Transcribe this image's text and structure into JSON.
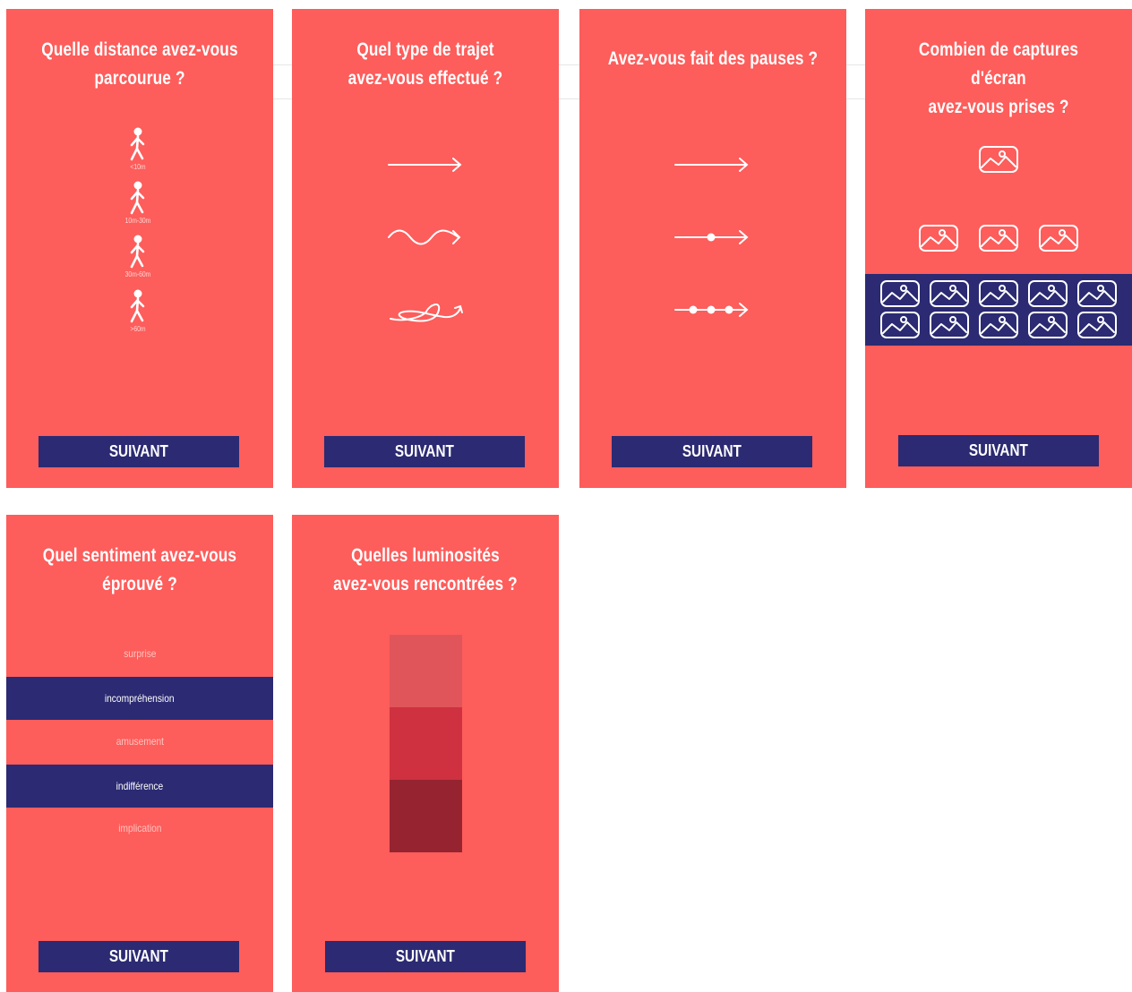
{
  "screens": [
    {
      "title_lines": [
        "Quelle distance avez-vous",
        "parcourue ?"
      ],
      "distance_labels": [
        "<10m",
        "10m-30m",
        "30m-60m",
        ">60m"
      ],
      "button": "SUIVANT"
    },
    {
      "title_lines": [
        "Quel type de trajet",
        "avez-vous effectué ?"
      ],
      "trajet_types": [
        "straight-arrow-icon",
        "wavy-arrow-icon",
        "looped-arrow-icon"
      ],
      "button": "SUIVANT"
    },
    {
      "title_lines": [
        "Avez-vous fait des pauses ?"
      ],
      "pause_options": [
        "no-pause-arrow-icon",
        "one-pause-arrow-icon",
        "three-pause-arrow-icon"
      ],
      "button": "SUIVANT"
    },
    {
      "title_lines": [
        "Combien de captures d'écran",
        "avez-vous prises ?"
      ],
      "capture_options": [
        1,
        3,
        10
      ],
      "selected_capture_option": 10,
      "button": "SUIVANT"
    },
    {
      "title_lines": [
        "Quel sentiment avez-vous",
        "éprouvé ?"
      ],
      "sentiments": [
        {
          "label": "surprise",
          "selected": false
        },
        {
          "label": "incompréhension",
          "selected": true
        },
        {
          "label": "amusement",
          "selected": false
        },
        {
          "label": "indifférence",
          "selected": true
        },
        {
          "label": "implication",
          "selected": false
        }
      ],
      "button": "SUIVANT"
    },
    {
      "title_lines": [
        "Quelles luminosités",
        "avez-vous rencontrées ?"
      ],
      "luminosity_swatches": [
        "#e0555a",
        "#cf3140",
        "#952430"
      ],
      "button": "SUIVANT"
    }
  ],
  "colors": {
    "background": "#fd5d5b",
    "accent": "#2b2a72",
    "text": "#ffffff"
  }
}
